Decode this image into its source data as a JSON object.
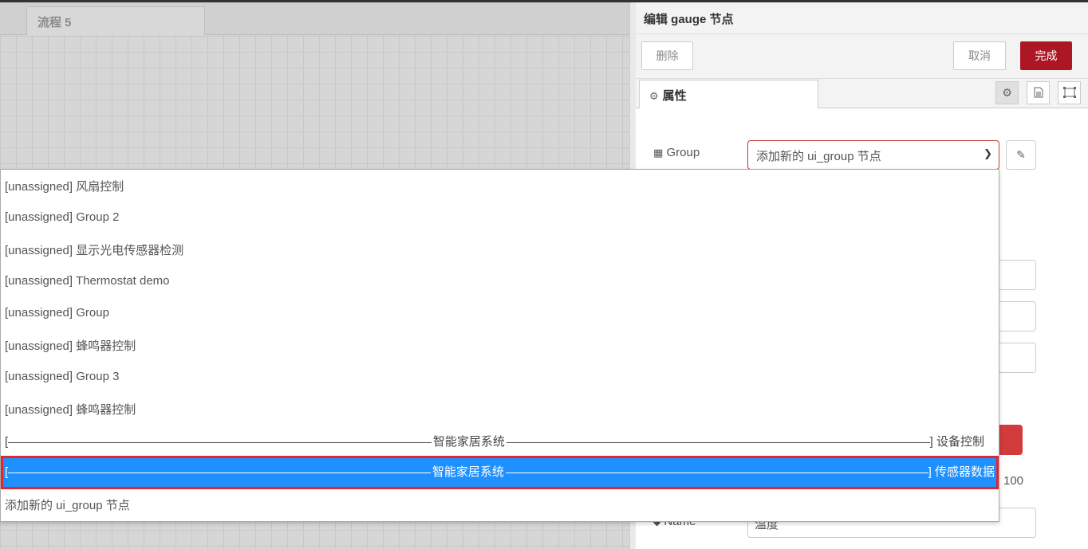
{
  "workspace": {
    "tab_label": "流程 5"
  },
  "panel": {
    "title": "编辑 gauge 节点",
    "delete_label": "删除",
    "cancel_label": "取消",
    "done_label": "完成",
    "properties_tab": "属性",
    "group_label": "Group",
    "group_selected": "添加新的 ui_group 节点",
    "name_label": "Name",
    "name_value": "温度",
    "max_value_partial": "100"
  },
  "dropdown": {
    "options": [
      "[unassigned] 风扇控制",
      "[unassigned] Group 2",
      "[unassigned] 显示光电传感器检测",
      "[unassigned] Thermostat demo",
      "[unassigned] Group",
      "[unassigned] 蜂鸣器控制",
      "[unassigned] Group 3",
      "[unassigned] 蜂鸣器控制"
    ],
    "sep1": {
      "left": "[",
      "mid": "智能家居系统",
      "right": "] 设备控制"
    },
    "sep2": {
      "left": "[",
      "mid": "智能家居系统",
      "right": "] 传感器数据"
    },
    "add_new": "添加新的 ui_group 节点"
  },
  "colors": {
    "done_button": "#ad1625",
    "selected_option": "#1e90ff",
    "highlight_outline": "#e0262d"
  }
}
